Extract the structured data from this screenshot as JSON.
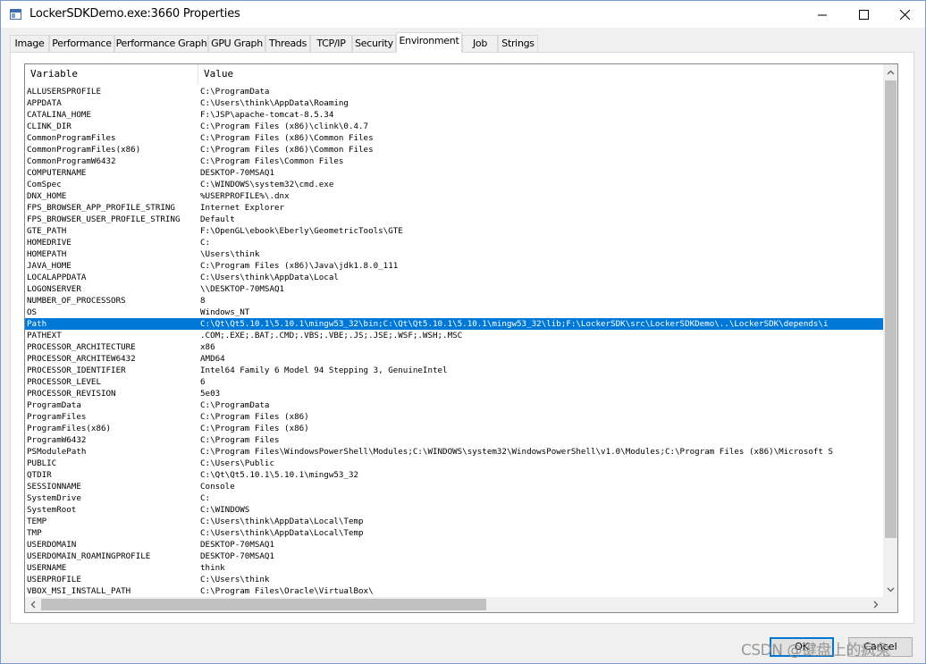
{
  "window": {
    "title": "LockerSDKDemo.exe:3660 Properties",
    "minimize_icon": "minimize-icon",
    "maximize_icon": "maximize-icon",
    "close_icon": "close-icon"
  },
  "tabs": [
    {
      "label": "Image"
    },
    {
      "label": "Performance"
    },
    {
      "label": "Performance Graph"
    },
    {
      "label": "GPU Graph"
    },
    {
      "label": "Threads"
    },
    {
      "label": "TCP/IP"
    },
    {
      "label": "Security"
    },
    {
      "label": "Environment",
      "active": true
    },
    {
      "label": "Job"
    },
    {
      "label": "Strings"
    }
  ],
  "list": {
    "columns": {
      "variable": "Variable",
      "value": "Value"
    },
    "selected_index": 20,
    "rows": [
      {
        "variable": "ALLUSERSPROFILE",
        "value": "C:\\ProgramData"
      },
      {
        "variable": "APPDATA",
        "value": "C:\\Users\\think\\AppData\\Roaming"
      },
      {
        "variable": "CATALINA_HOME",
        "value": "F:\\JSP\\apache-tomcat-8.5.34"
      },
      {
        "variable": "CLINK_DIR",
        "value": "C:\\Program Files (x86)\\clink\\0.4.7"
      },
      {
        "variable": "CommonProgramFiles",
        "value": "C:\\Program Files (x86)\\Common Files"
      },
      {
        "variable": "CommonProgramFiles(x86)",
        "value": "C:\\Program Files (x86)\\Common Files"
      },
      {
        "variable": "CommonProgramW6432",
        "value": "C:\\Program Files\\Common Files"
      },
      {
        "variable": "COMPUTERNAME",
        "value": "DESKTOP-70MSAQ1"
      },
      {
        "variable": "ComSpec",
        "value": "C:\\WINDOWS\\system32\\cmd.exe"
      },
      {
        "variable": "DNX_HOME",
        "value": "%USERPROFILE%\\.dnx"
      },
      {
        "variable": "FPS_BROWSER_APP_PROFILE_STRING",
        "value": "Internet Explorer"
      },
      {
        "variable": "FPS_BROWSER_USER_PROFILE_STRING",
        "value": "Default"
      },
      {
        "variable": "GTE_PATH",
        "value": "F:\\OpenGL\\ebook\\Eberly\\GeometricTools\\GTE"
      },
      {
        "variable": "HOMEDRIVE",
        "value": "C:"
      },
      {
        "variable": "HOMEPATH",
        "value": "\\Users\\think"
      },
      {
        "variable": "JAVA_HOME",
        "value": "C:\\Program Files (x86)\\Java\\jdk1.8.0_111"
      },
      {
        "variable": "LOCALAPPDATA",
        "value": "C:\\Users\\think\\AppData\\Local"
      },
      {
        "variable": "LOGONSERVER",
        "value": "\\\\DESKTOP-70MSAQ1"
      },
      {
        "variable": "NUMBER_OF_PROCESSORS",
        "value": "8"
      },
      {
        "variable": "OS",
        "value": "Windows_NT"
      },
      {
        "variable": "Path",
        "value": "C:\\Qt\\Qt5.10.1\\5.10.1\\mingw53_32\\bin;C:\\Qt\\Qt5.10.1\\5.10.1\\mingw53_32\\lib;F:\\LockerSDK\\src\\LockerSDKDemo\\..\\LockerSDK\\depends\\i"
      },
      {
        "variable": "PATHEXT",
        "value": ".COM;.EXE;.BAT;.CMD;.VBS;.VBE;.JS;.JSE;.WSF;.WSH;.MSC"
      },
      {
        "variable": "PROCESSOR_ARCHITECTURE",
        "value": "x86"
      },
      {
        "variable": "PROCESSOR_ARCHITEW6432",
        "value": "AMD64"
      },
      {
        "variable": "PROCESSOR_IDENTIFIER",
        "value": "Intel64 Family 6 Model 94 Stepping 3, GenuineIntel"
      },
      {
        "variable": "PROCESSOR_LEVEL",
        "value": "6"
      },
      {
        "variable": "PROCESSOR_REVISION",
        "value": "5e03"
      },
      {
        "variable": "ProgramData",
        "value": "C:\\ProgramData"
      },
      {
        "variable": "ProgramFiles",
        "value": "C:\\Program Files (x86)"
      },
      {
        "variable": "ProgramFiles(x86)",
        "value": "C:\\Program Files (x86)"
      },
      {
        "variable": "ProgramW6432",
        "value": "C:\\Program Files"
      },
      {
        "variable": "PSModulePath",
        "value": "C:\\Program Files\\WindowsPowerShell\\Modules;C:\\WINDOWS\\system32\\WindowsPowerShell\\v1.0\\Modules;C:\\Program Files (x86)\\Microsoft S"
      },
      {
        "variable": "PUBLIC",
        "value": "C:\\Users\\Public"
      },
      {
        "variable": "QTDIR",
        "value": "C:\\Qt\\Qt5.10.1\\5.10.1\\mingw53_32"
      },
      {
        "variable": "SESSIONNAME",
        "value": "Console"
      },
      {
        "variable": "SystemDrive",
        "value": "C:"
      },
      {
        "variable": "SystemRoot",
        "value": "C:\\WINDOWS"
      },
      {
        "variable": "TEMP",
        "value": "C:\\Users\\think\\AppData\\Local\\Temp"
      },
      {
        "variable": "TMP",
        "value": "C:\\Users\\think\\AppData\\Local\\Temp"
      },
      {
        "variable": "USERDOMAIN",
        "value": "DESKTOP-70MSAQ1"
      },
      {
        "variable": "USERDOMAIN_ROAMINGPROFILE",
        "value": "DESKTOP-70MSAQ1"
      },
      {
        "variable": "USERNAME",
        "value": "think"
      },
      {
        "variable": "USERPROFILE",
        "value": "C:\\Users\\think"
      },
      {
        "variable": "VBOX_MSI_INSTALL_PATH",
        "value": "C:\\Program Files\\Oracle\\VirtualBox\\"
      }
    ]
  },
  "buttons": {
    "ok": "OK",
    "cancel": "Cancel"
  },
  "watermark": "CSDN @键盘上的疯兔",
  "colors": {
    "selection": "#0078d7",
    "accent": "#0078d7"
  }
}
